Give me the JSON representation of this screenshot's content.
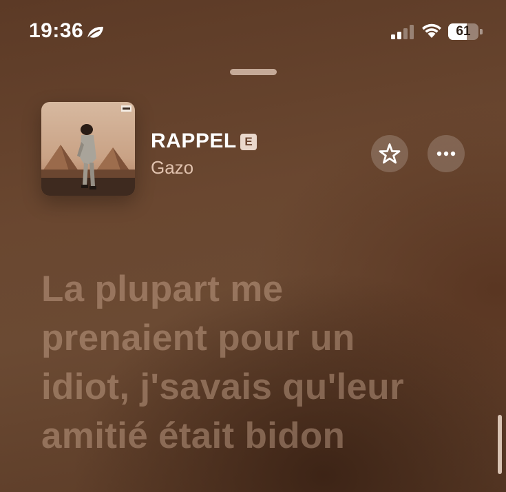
{
  "status_bar": {
    "time": "19:36",
    "battery_level": 61,
    "battery_label": "61",
    "focus_icon": "leaf-icon",
    "signal_icon": "cellular-signal-icon",
    "wifi_icon": "wifi-icon"
  },
  "now_playing": {
    "title": "RAPPEL",
    "explicit_badge": "E",
    "artist": "Gazo",
    "artwork_icon": "album-artwork",
    "favorite_icon": "star-icon",
    "more_icon": "ellipsis-icon"
  },
  "lyrics": {
    "lines": [
      "La plupart me",
      "prenaient pour un",
      "idiot, j'savais qu'leur",
      "amitié était bidon"
    ]
  },
  "colors": {
    "background": "#6a4730",
    "lyric_text": "#dcb9a0",
    "artist_text": "#e0c2ae",
    "badge_bg": "#ead8cc"
  }
}
